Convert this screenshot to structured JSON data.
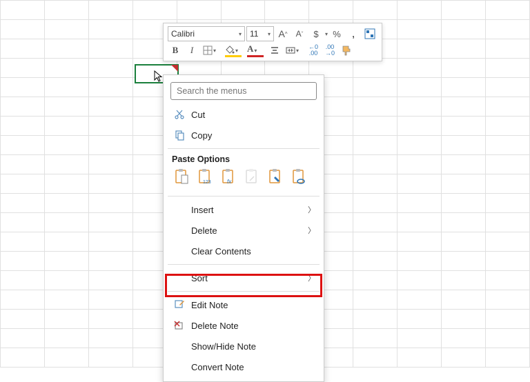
{
  "toolbar": {
    "font_name": "Calibri",
    "font_size": "11",
    "bold": "B",
    "italic": "I",
    "increase_font_tip": "A^",
    "decrease_font_tip": "Aˇ"
  },
  "search": {
    "placeholder": "Search the menus"
  },
  "menu": {
    "cut": "Cut",
    "copy": "Copy",
    "paste_options_header": "Paste Options",
    "insert": "Insert",
    "delete": "Delete",
    "clear_contents": "Clear Contents",
    "sort": "Sort",
    "edit_note": "Edit Note",
    "delete_note": "Delete Note",
    "show_hide_note": "Show/Hide Note",
    "convert_note": "Convert Note"
  },
  "colors": {
    "fill_strip": "#ffcc00",
    "font_strip": "#d02424"
  }
}
